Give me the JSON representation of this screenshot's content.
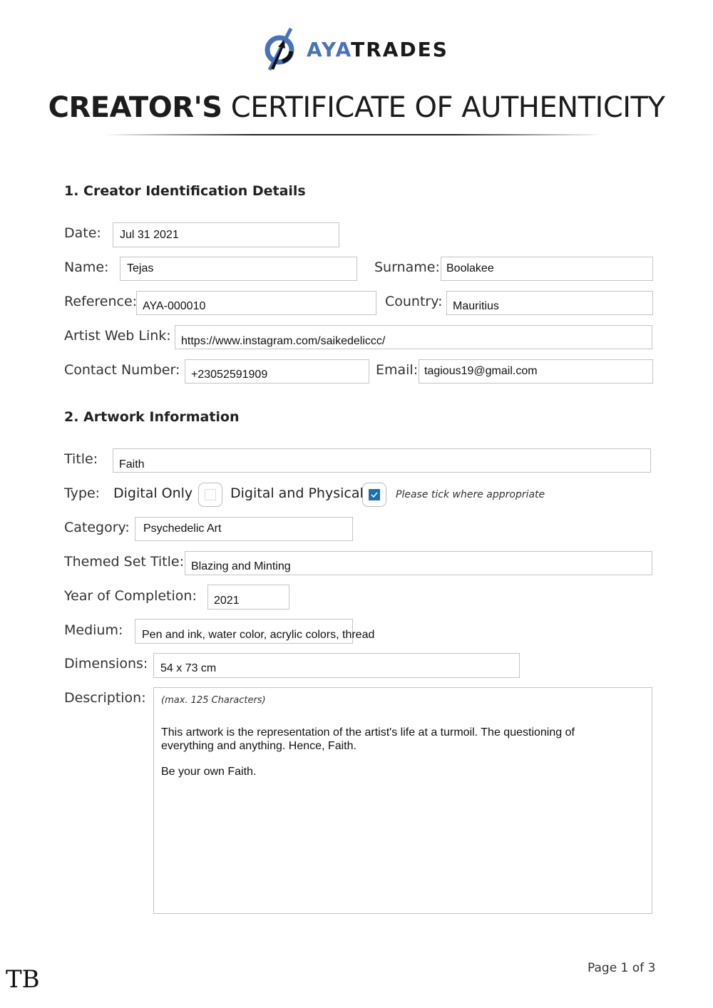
{
  "brand": {
    "name_part1": "AYA",
    "name_part2": "TRADES",
    "accent_color": "#4a72b8",
    "logo_icon": "ayatrades-logo-icon"
  },
  "header": {
    "title_bold": "CREATOR'S",
    "title_light": "CERTIFICATE OF AUTHENTICITY"
  },
  "section1": {
    "heading": "1. Creator Identification Details",
    "fields": {
      "date": {
        "label": "Date:",
        "value": "Jul 31 2021"
      },
      "name": {
        "label": "Name:",
        "value": "Tejas"
      },
      "surname": {
        "label": "Surname:",
        "value": "Boolakee"
      },
      "reference": {
        "label": "Reference:",
        "value": "AYA-000010"
      },
      "country": {
        "label": "Country:",
        "value": "Mauritius"
      },
      "web_link": {
        "label": "Artist Web Link:",
        "value": "https://www.instagram.com/saikedeliccc/"
      },
      "contact": {
        "label": "Contact Number:",
        "value": "+23052591909"
      },
      "email": {
        "label": "Email:",
        "value": "tagious19@gmail.com"
      }
    }
  },
  "section2": {
    "heading": "2. Artwork Information",
    "fields": {
      "title": {
        "label": "Title:",
        "value": "Faith"
      },
      "type": {
        "label": "Type:",
        "options": [
          {
            "label": "Digital Only",
            "checked": false
          },
          {
            "label": "Digital and Physical",
            "checked": true
          }
        ],
        "hint": "Please tick where appropriate"
      },
      "category": {
        "label": "Category:",
        "value": "Psychedelic Art"
      },
      "themed_set": {
        "label": "Themed Set Title:",
        "value": "Blazing and Minting"
      },
      "year": {
        "label": "Year of Completion:",
        "value": "2021"
      },
      "medium": {
        "label": "Medium:",
        "value": "Pen and ink, water color, acrylic colors, thread"
      },
      "dimensions": {
        "label": "Dimensions:",
        "value": "54 x 73 cm"
      },
      "description": {
        "label": "Description:",
        "note": "(max. 125 Characters)",
        "paragraph1": "This artwork is the representation of the artist's life at a turmoil. The questioning of everything and anything. Hence, Faith.",
        "paragraph2": "Be your own Faith."
      }
    }
  },
  "footer": {
    "initials": "TB",
    "page_label": "Page 1 of 3"
  }
}
